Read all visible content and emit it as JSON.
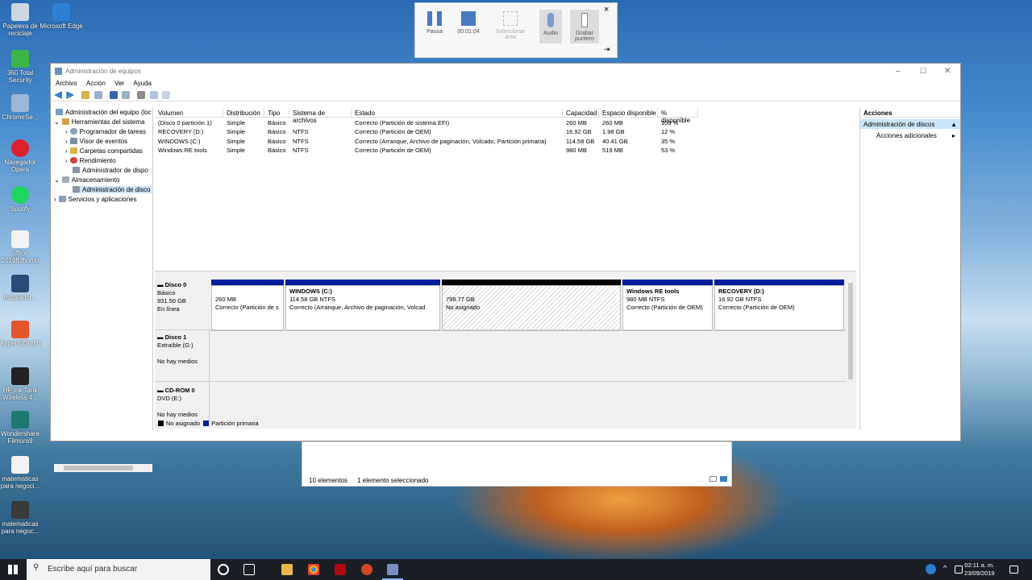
{
  "desktop_icons": [
    {
      "label": "Papelera de reciclaje",
      "color": "#cfd8e0"
    },
    {
      "label": "Microsoft Edge",
      "color": "#2d7fd3"
    },
    {
      "label": "360 Total Security",
      "color": "#3cb44a"
    },
    {
      "label": "ChromeSe...",
      "color": "#9fb7d6"
    },
    {
      "label": "Navegador Opera",
      "color": "#e0202e"
    },
    {
      "label": "Spotify",
      "color": "#1ed760"
    },
    {
      "label": "office 2019fhfhumb",
      "color": "#f2f2f2"
    },
    {
      "label": "Instalador...",
      "color": "#2b4a7a"
    },
    {
      "label": "Aspel NOI 8.0",
      "color": "#e5552a"
    },
    {
      "label": "HP Ink Tank Wireless 4...",
      "color": "#222222"
    },
    {
      "label": "Wondershare Filmora9",
      "color": "#1d7a70"
    },
    {
      "label": "matematicas para negoci...",
      "color": "#f2f2f2"
    },
    {
      "label": "matematicas para negoc...",
      "color": "#3a3a3a"
    }
  ],
  "recorder": {
    "pause": "Pausa",
    "time": "00:01:04",
    "select": "Seleccionar área",
    "audio": "Audio",
    "pointer": "Grabar puntero",
    "close": "×",
    "pin": "⇥"
  },
  "window": {
    "title": "Administración de equipos",
    "menu": [
      "Archivo",
      "Acción",
      "Ver",
      "Ayuda"
    ],
    "tree": [
      "Administración del equipo (loc",
      "Herramientas del sistema",
      "Programador de tareas",
      "Visor de eventos",
      "Carpetas compartidas",
      "Rendimiento",
      "Administrador de dispo",
      "Almacenamiento",
      "Administración de disco",
      "Servicios y aplicaciones"
    ],
    "columns": [
      "Volumen",
      "Distribución",
      "Tipo",
      "Sistema de archivos",
      "Estado",
      "Capacidad",
      "Espacio disponible",
      "% disponible"
    ],
    "rows": [
      [
        "(Disco 0 partición 1)",
        "Simple",
        "Básico",
        "",
        "Correcto (Partición de sistema EFI)",
        "260 MB",
        "260 MB",
        "100 %"
      ],
      [
        "RECOVERY (D:)",
        "Simple",
        "Básico",
        "NTFS",
        "Correcto (Partición de OEM)",
        "16.92 GB",
        "1.98 GB",
        "12 %"
      ],
      [
        "WINDOWS (C:)",
        "Simple",
        "Básico",
        "NTFS",
        "Correcto (Arranque, Archivo de paginación, Volcado, Partición primaria)",
        "114.58 GB",
        "40.41 GB",
        "35 %"
      ],
      [
        "Windows RE tools",
        "Simple",
        "Básico",
        "NTFS",
        "Correcto (Partición de OEM)",
        "980 MB",
        "519 MB",
        "53 %"
      ]
    ],
    "disk0": {
      "name": "Disco 0",
      "type": "Básico",
      "size": "931.50 GB",
      "status": "En línea"
    },
    "partitions": [
      {
        "name": "",
        "size": "260 MB",
        "status": "Correcto (Partición de s"
      },
      {
        "name": "WINDOWS  (C:)",
        "size": "114.58 GB NTFS",
        "status": "Correcto (Arranque, Archivo de paginación, Volcad"
      },
      {
        "name": "",
        "size": "798.77 GB",
        "status": "No asignado"
      },
      {
        "name": "Windows RE tools",
        "size": "980 MB NTFS",
        "status": "Correcto (Partición de OEM)"
      },
      {
        "name": "RECOVERY  (D:)",
        "size": "16.92 GB NTFS",
        "status": "Correcto (Partición de OEM)"
      }
    ],
    "disk1": {
      "name": "Disco 1",
      "type": "Extraíble (G:)",
      "media": "No hay medios"
    },
    "cdrom": {
      "name": "CD-ROM 0",
      "type": "DVD (E:)",
      "media": "No hay medios"
    },
    "legend": {
      "unassigned": "No asignado",
      "primary": "Partición primaria"
    },
    "actions": {
      "header": "Acciones",
      "section": "Administración de discos",
      "more": "Acciones adicionales"
    }
  },
  "explorer": {
    "items": "10 elementos",
    "selected": "1 elemento seleccionado"
  },
  "taskbar": {
    "search_placeholder": "Escribe aquí para buscar",
    "time": "02:11 a. m.",
    "date": "23/09/2019"
  }
}
